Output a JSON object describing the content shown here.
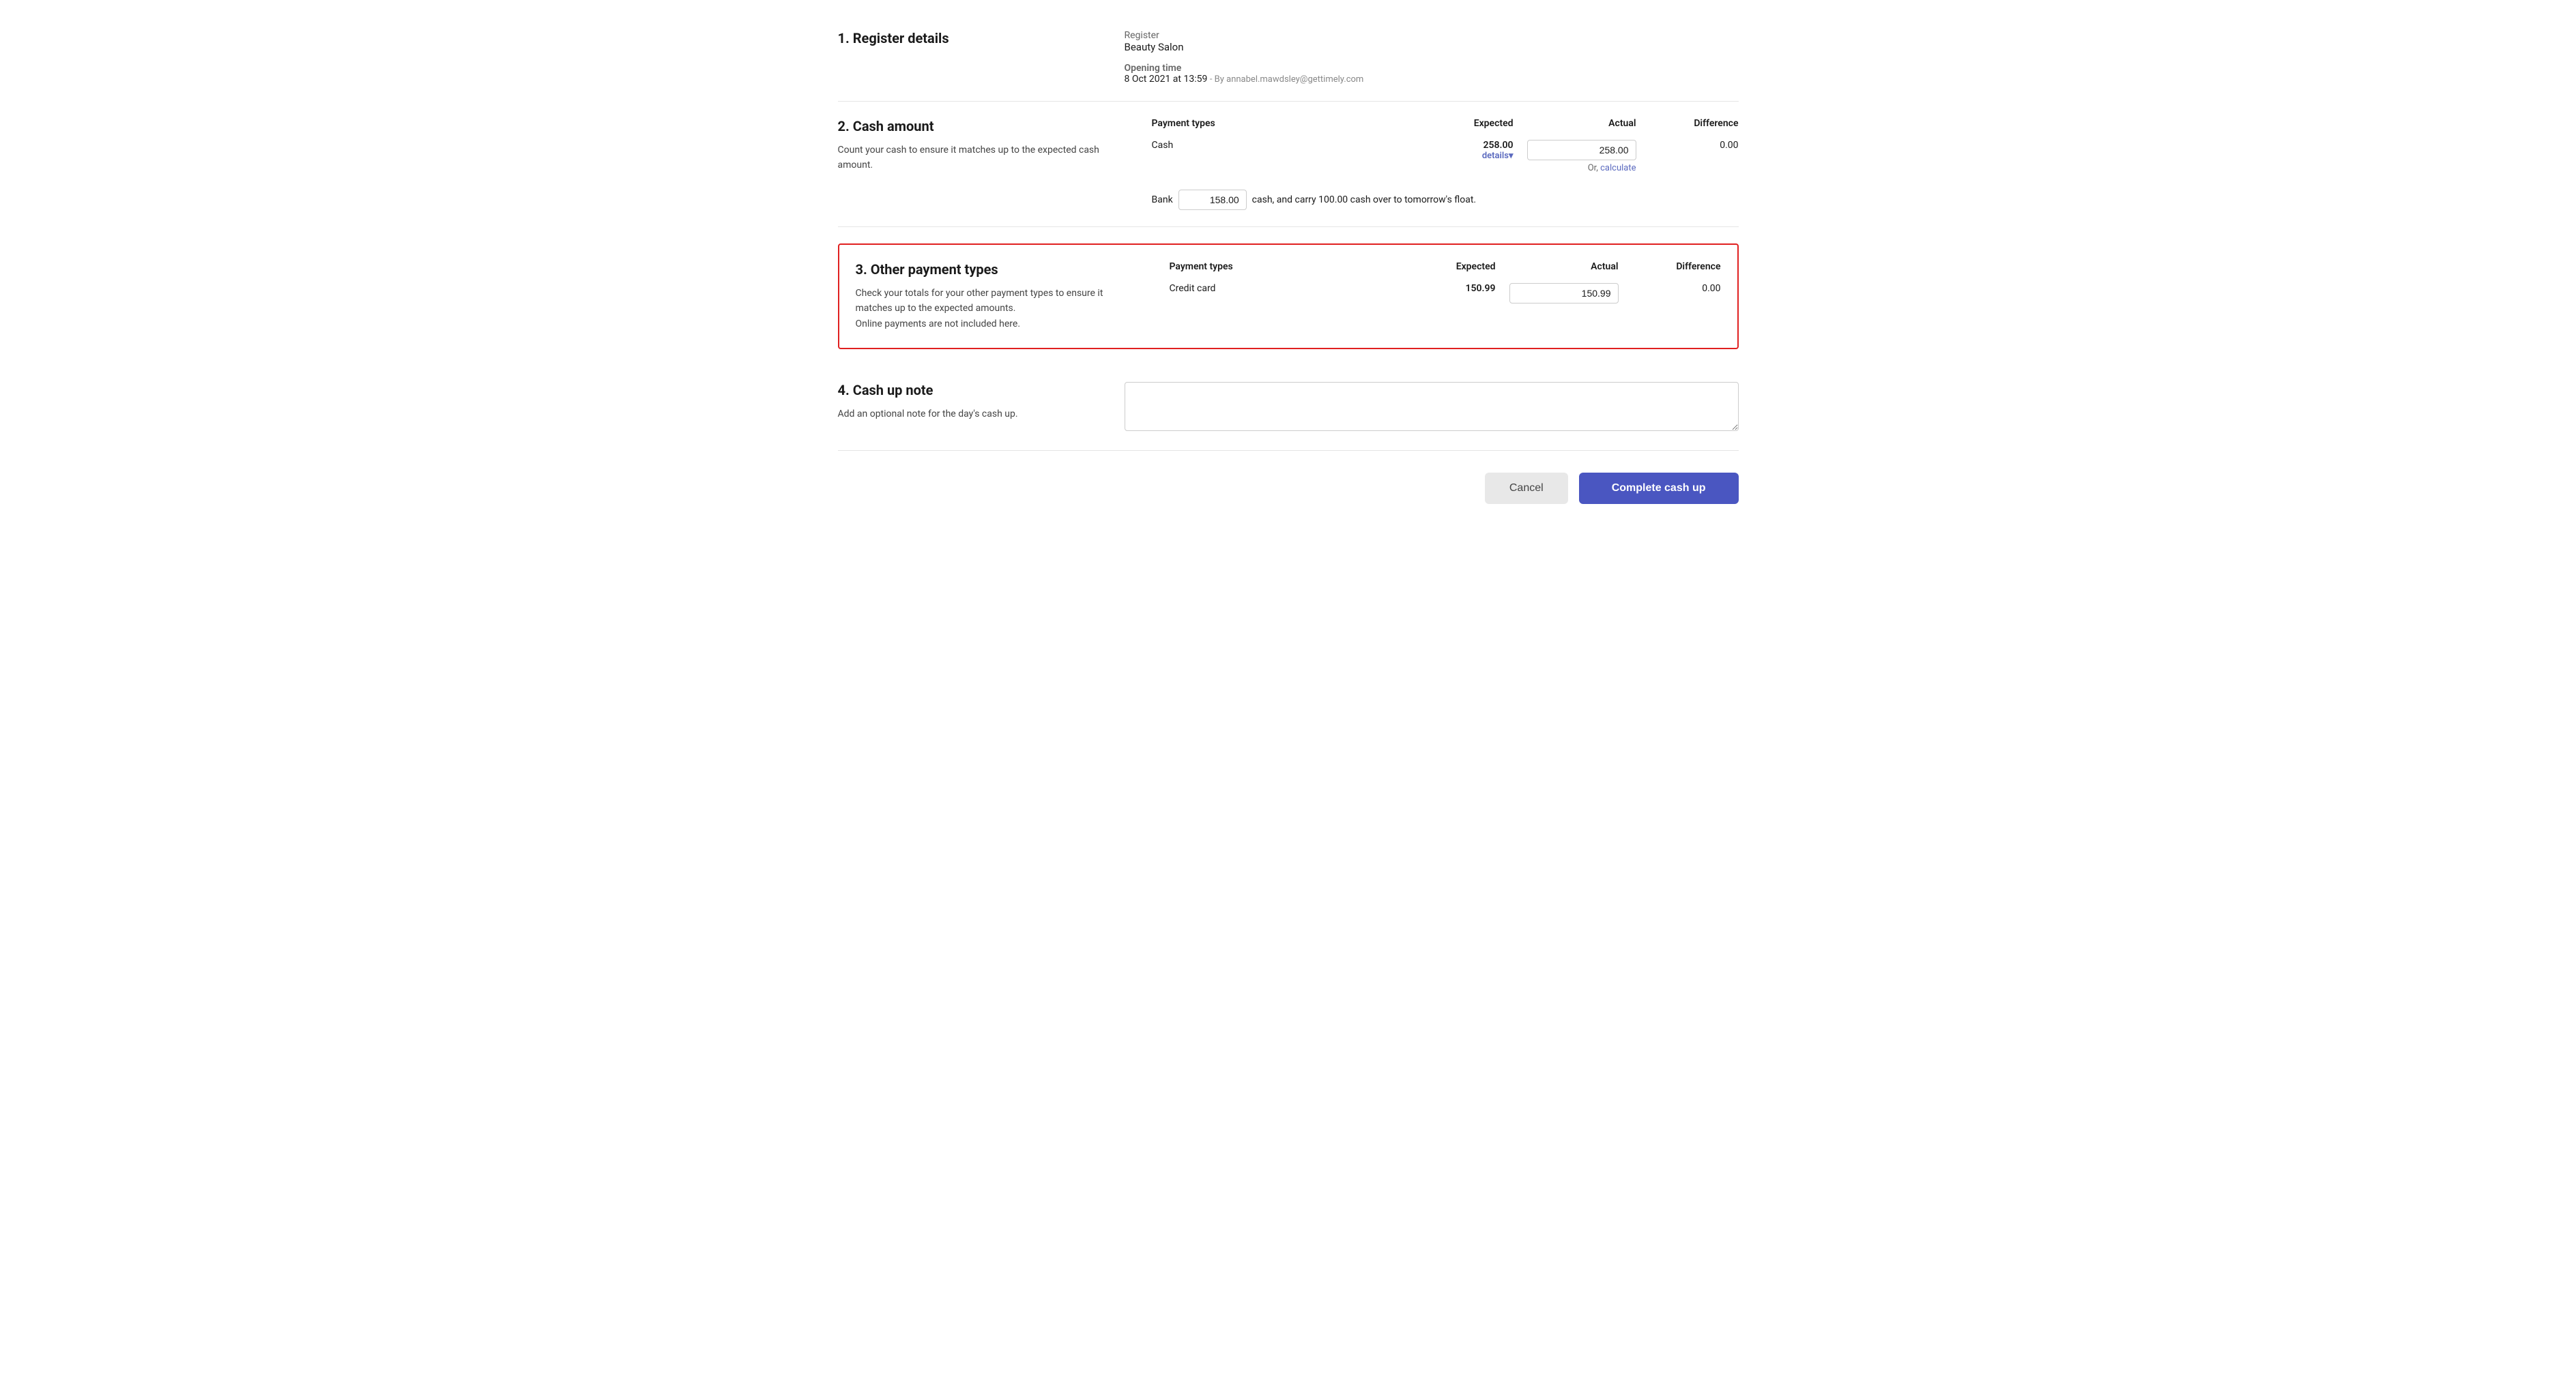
{
  "section1": {
    "heading": "1. Register details",
    "register_label": "Register",
    "register_value": "Beauty Salon",
    "opening_time_label": "Opening time",
    "opening_time_value": "8 Oct 2021 at 13:59",
    "opening_time_by": "- By annabel.mawdsley@gettimely.com"
  },
  "section2": {
    "heading": "2. Cash amount",
    "description": "Count your cash to ensure it matches up to the expected cash amount.",
    "col_payment_types": "Payment types",
    "col_expected": "Expected",
    "col_actual": "Actual",
    "col_difference": "Difference",
    "cash_label": "Cash",
    "cash_expected": "258.00",
    "cash_actual": "258.00",
    "cash_difference": "0.00",
    "details_link": "details",
    "details_arrow": "▾",
    "or_text": "Or,",
    "calculate_link": "calculate",
    "bank_label": "Bank",
    "bank_value": "158.00",
    "bank_suffix": "cash, and carry 100.00 cash over to tomorrow's float."
  },
  "section3": {
    "heading": "3. Other payment types",
    "description_line1": "Check your totals for your other payment types to ensure it matches up to the expected amounts.",
    "description_line2": "Online payments are not included here.",
    "col_payment_types": "Payment types",
    "col_expected": "Expected",
    "col_actual": "Actual",
    "col_difference": "Difference",
    "credit_card_label": "Credit card",
    "credit_card_expected": "150.99",
    "credit_card_actual": "150.99",
    "credit_card_difference": "0.00"
  },
  "section4": {
    "heading": "4. Cash up note",
    "description": "Add an optional note for the day's cash up.",
    "placeholder": ""
  },
  "footer": {
    "cancel_label": "Cancel",
    "complete_label": "Complete cash up"
  }
}
